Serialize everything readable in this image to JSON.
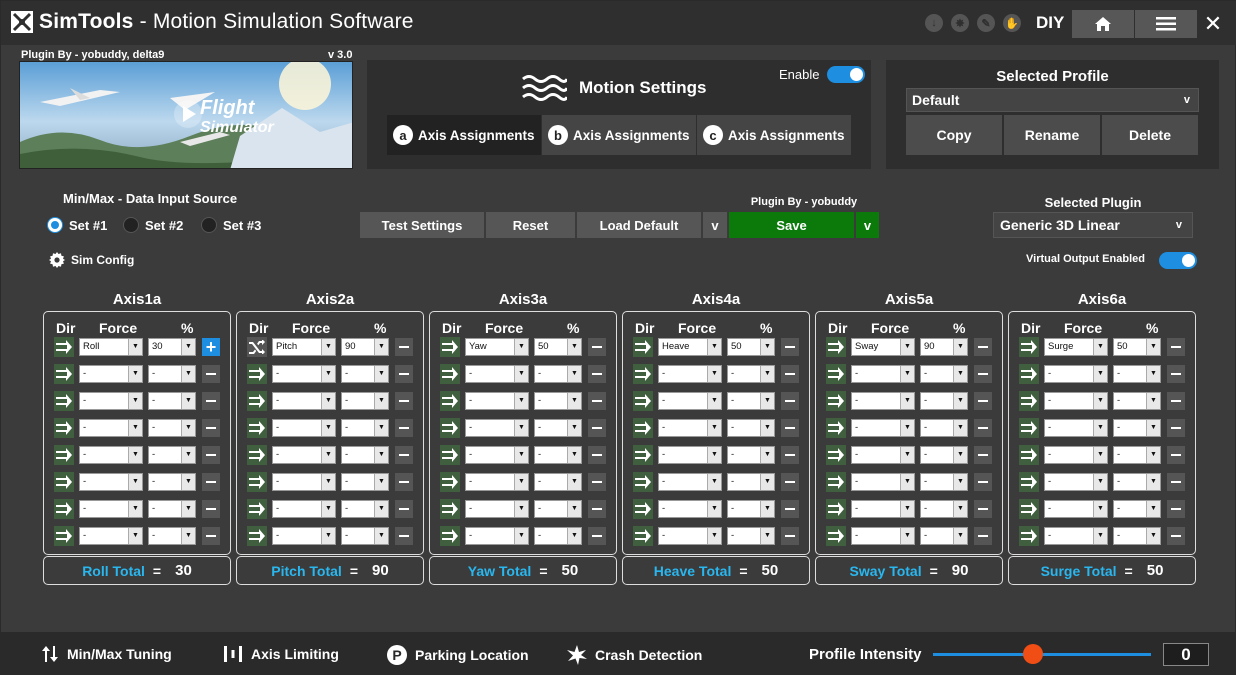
{
  "window": {
    "title_brand": "SimTools",
    "title_rest": " - Motion Simulation Software",
    "mode": "DIY"
  },
  "plugin": {
    "by": "Plugin By - yobuddy, delta9",
    "version": "v 3.0"
  },
  "motion": {
    "title": "Motion Settings",
    "enable_label": "Enable",
    "enabled": true,
    "tabs": [
      {
        "badge": "a",
        "label": "Axis Assignments"
      },
      {
        "badge": "b",
        "label": "Axis Assignments"
      },
      {
        "badge": "c",
        "label": "Axis Assignments"
      }
    ]
  },
  "profile": {
    "title": "Selected Profile",
    "selected": "Default",
    "copy": "Copy",
    "rename": "Rename",
    "delete": "Delete"
  },
  "minmax": {
    "label": "Min/Max - Data Input Source",
    "sets": [
      "Set #1",
      "Set #2",
      "Set #3"
    ],
    "selected_index": 0
  },
  "actions": {
    "test": "Test Settings",
    "reset": "Reset",
    "load_default": "Load Default",
    "dropdown": "v",
    "save": "Save",
    "save_dropdown": "v",
    "plugin_by": "Plugin By - yobuddy"
  },
  "selected_plugin": {
    "label": "Selected Plugin",
    "value": "Generic 3D Linear"
  },
  "sim_config": "Sim Config",
  "virtual_output": {
    "label": "Virtual Output Enabled",
    "enabled": true
  },
  "columns": {
    "dir": "Dir",
    "force": "Force",
    "pct": "%"
  },
  "axes": [
    {
      "name": "Axis1a",
      "force": "Roll",
      "pct": "30",
      "total_label": "Roll Total",
      "total": "30"
    },
    {
      "name": "Axis2a",
      "force": "Pitch",
      "pct": "90",
      "total_label": "Pitch Total",
      "total": "90"
    },
    {
      "name": "Axis3a",
      "force": "Yaw",
      "pct": "50",
      "total_label": "Yaw Total",
      "total": "50"
    },
    {
      "name": "Axis4a",
      "force": "Heave",
      "pct": "50",
      "total_label": "Heave Total",
      "total": "50"
    },
    {
      "name": "Axis5a",
      "force": "Sway",
      "pct": "90",
      "total_label": "Sway Total",
      "total": "90"
    },
    {
      "name": "Axis6a",
      "force": "Surge",
      "pct": "50",
      "total_label": "Surge Total",
      "total": "50"
    }
  ],
  "empty_value": "-",
  "total_eq": "=",
  "bottom": {
    "minmax": "Min/Max Tuning",
    "limiting": "Axis Limiting",
    "parking": "Parking Location",
    "crash": "Crash Detection",
    "intensity_label": "Profile Intensity",
    "intensity_value": "0",
    "intensity_level": 0.46
  },
  "colors": {
    "accent": "#1e8fe0",
    "save": "#0b7a0b",
    "total_label": "#29b7f0",
    "thumb": "#f04e14"
  }
}
